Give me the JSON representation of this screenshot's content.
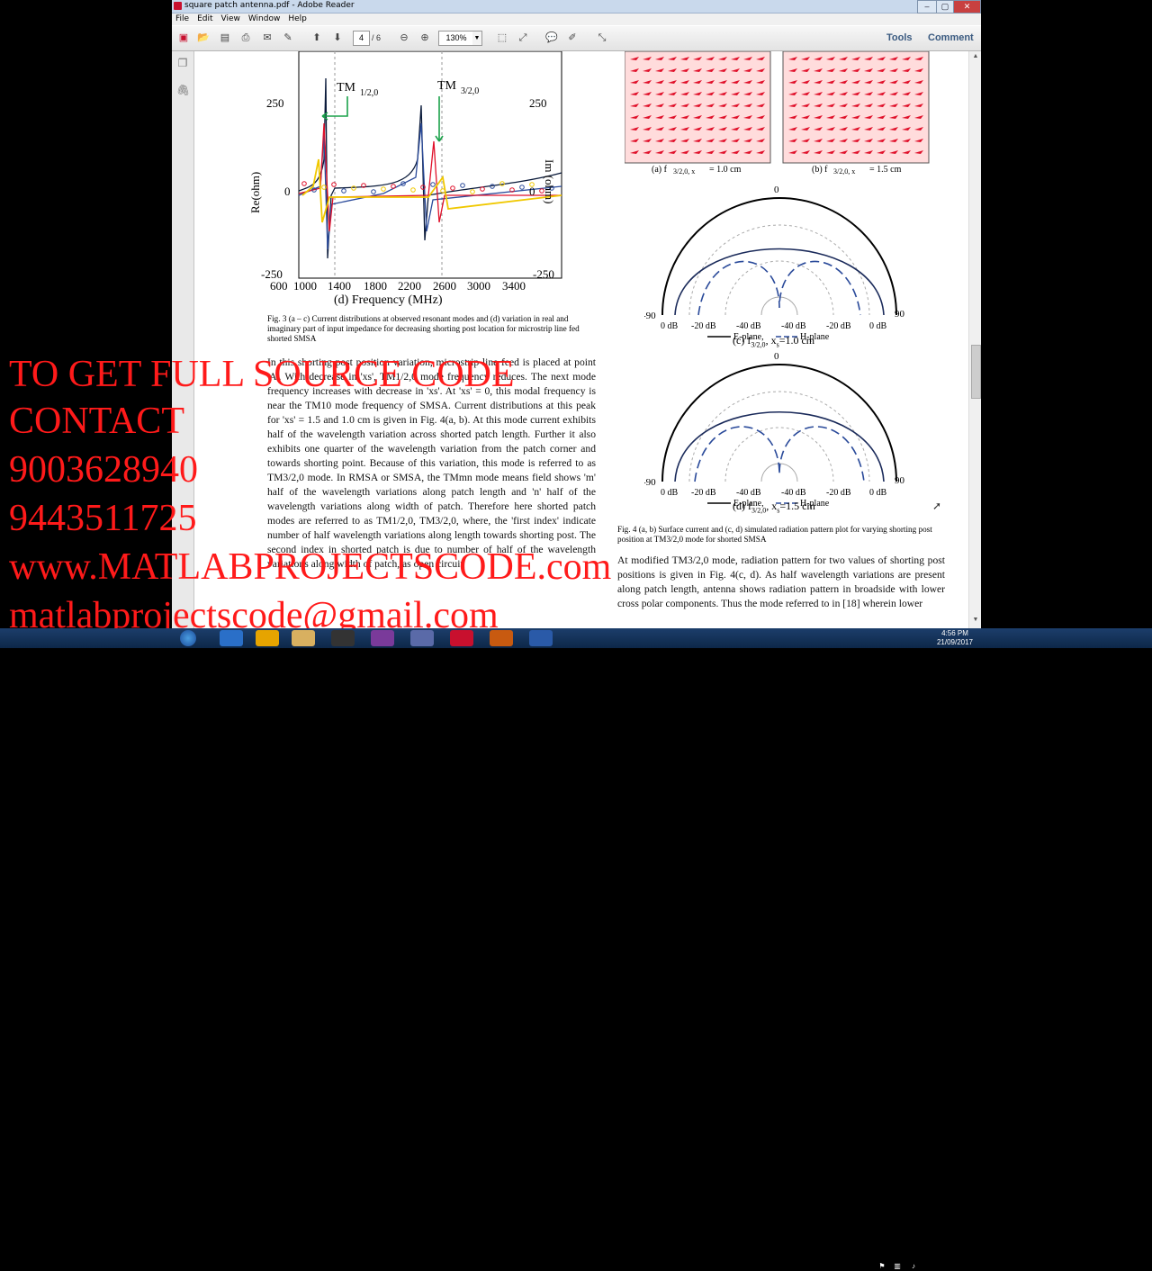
{
  "window": {
    "title": "square patch antenna.pdf - Adobe Reader",
    "menu": [
      "File",
      "Edit",
      "View",
      "Window",
      "Help"
    ],
    "controls": {
      "minimize": "–",
      "maximize": "▢",
      "close": "✕"
    }
  },
  "toolbar": {
    "page_current": "4",
    "page_total": "/ 6",
    "zoom": "130%",
    "tools_label": "Tools",
    "comment_label": "Comment"
  },
  "figure3": {
    "tm_left": "TM",
    "tm_left_sub": "1/2,0",
    "tm_right": "TM",
    "tm_right_sub": "3/2,0",
    "ylabel_left": "Re(ohm)",
    "ylabel_right": "Im (ohm)",
    "xlabel": "(d) Frequency (MHz)",
    "yticks_left": [
      "250",
      "0",
      "-250"
    ],
    "yticks_right": [
      "250",
      "0",
      "-250"
    ],
    "xticks": [
      "600",
      "1000",
      "1400",
      "1800",
      "2200",
      "2600",
      "3000",
      "3400"
    ],
    "caption": "Fig. 3 (a – c) Current distributions at observed resonant modes and (d) variation in real and imaginary part of input impedance for decreasing shorting post location for microstrip line fed shorted SMSA"
  },
  "figure4": {
    "sub_a": "(a) f",
    "sub_a_rest": "3/2,0, x",
    "sub_a_val": "= 1.0 cm",
    "sub_b": "(b) f",
    "sub_b_rest": "3/2,0, x",
    "sub_b_val": "= 1.5 cm",
    "polar_top": "0",
    "polar_left": "-90",
    "polar_right": "90",
    "db_ticks": [
      "0 dB",
      "-20 dB",
      "-40 dB",
      "-40 dB",
      "-20 dB",
      "0 dB"
    ],
    "legend_e": "E-plane,",
    "legend_h": "H-plane",
    "sub_c": "(c) f",
    "sub_c_sub": "3/2,0",
    "sub_c_val": ", x",
    "sub_c_end": "=1.0 cm",
    "sub_d": "(d) f",
    "sub_d_sub": "3/2,0",
    "sub_d_val": ", x",
    "sub_d_end": "=1.5 cm",
    "caption": "Fig. 4 (a, b) Surface current and (c, d) simulated radiation pattern plot for varying shorting post position at TM3/2,0 mode for shorted SMSA"
  },
  "body_left": "In this shorting post position variation, microstrip line feed is placed at point 'A'. With decrease in 'xs', TM1/2,0 mode frequency reduces. The next mode frequency increases with decrease in 'xs'. At 'xs' = 0, this modal frequency is near the TM10 mode frequency of SMSA. Current distributions at this peak for 'xs' = 1.5 and 1.0 cm is given in Fig. 4(a, b). At this mode current exhibits half of the wavelength variation across shorted patch length. Further it also exhibits one quarter of the wavelength variation from the patch corner and towards shorting point. Because of this variation, this mode is referred to as TM3/2,0 mode. In RMSA or SMSA, the TMmn mode means field shows 'm' half of the wavelength variations along patch length and 'n' half of the wavelength variations along width of patch. Therefore here shorted patch modes are referred to as TM1/2,0, TM3/2,0, where, the 'first index' indicate number of half wavelength variations along length towards shorting post. The second index in shorted patch is due to number of half of the wavelength variations along width of patch, as open circuit",
  "body_right": "At modified TM3/2,0 mode, radiation pattern for two values of shorting post positions is given in Fig. 4(c, d). As half wavelength variations are present along patch length, antenna shows radiation pattern in broadside with lower cross polar components. Thus the mode referred to in [18] wherein lower",
  "overlay": {
    "line1": "TO GET FULL SOURCE CODE",
    "line2": "CONTACT",
    "line3": "9003628940",
    "line4": "9443511725",
    "line5": "www.MATLABPROJECTSCODE.com",
    "line6": "matlabprojectscode@gmail.com",
    "color": "#ff1a1a"
  },
  "taskbar": {
    "time": "4:56 PM",
    "date": "21/09/2017"
  },
  "colors": {
    "accent": "#c8102e",
    "series_red": "#e0102a",
    "series_blue": "#2a4a9a",
    "series_yellow": "#f0c800"
  }
}
